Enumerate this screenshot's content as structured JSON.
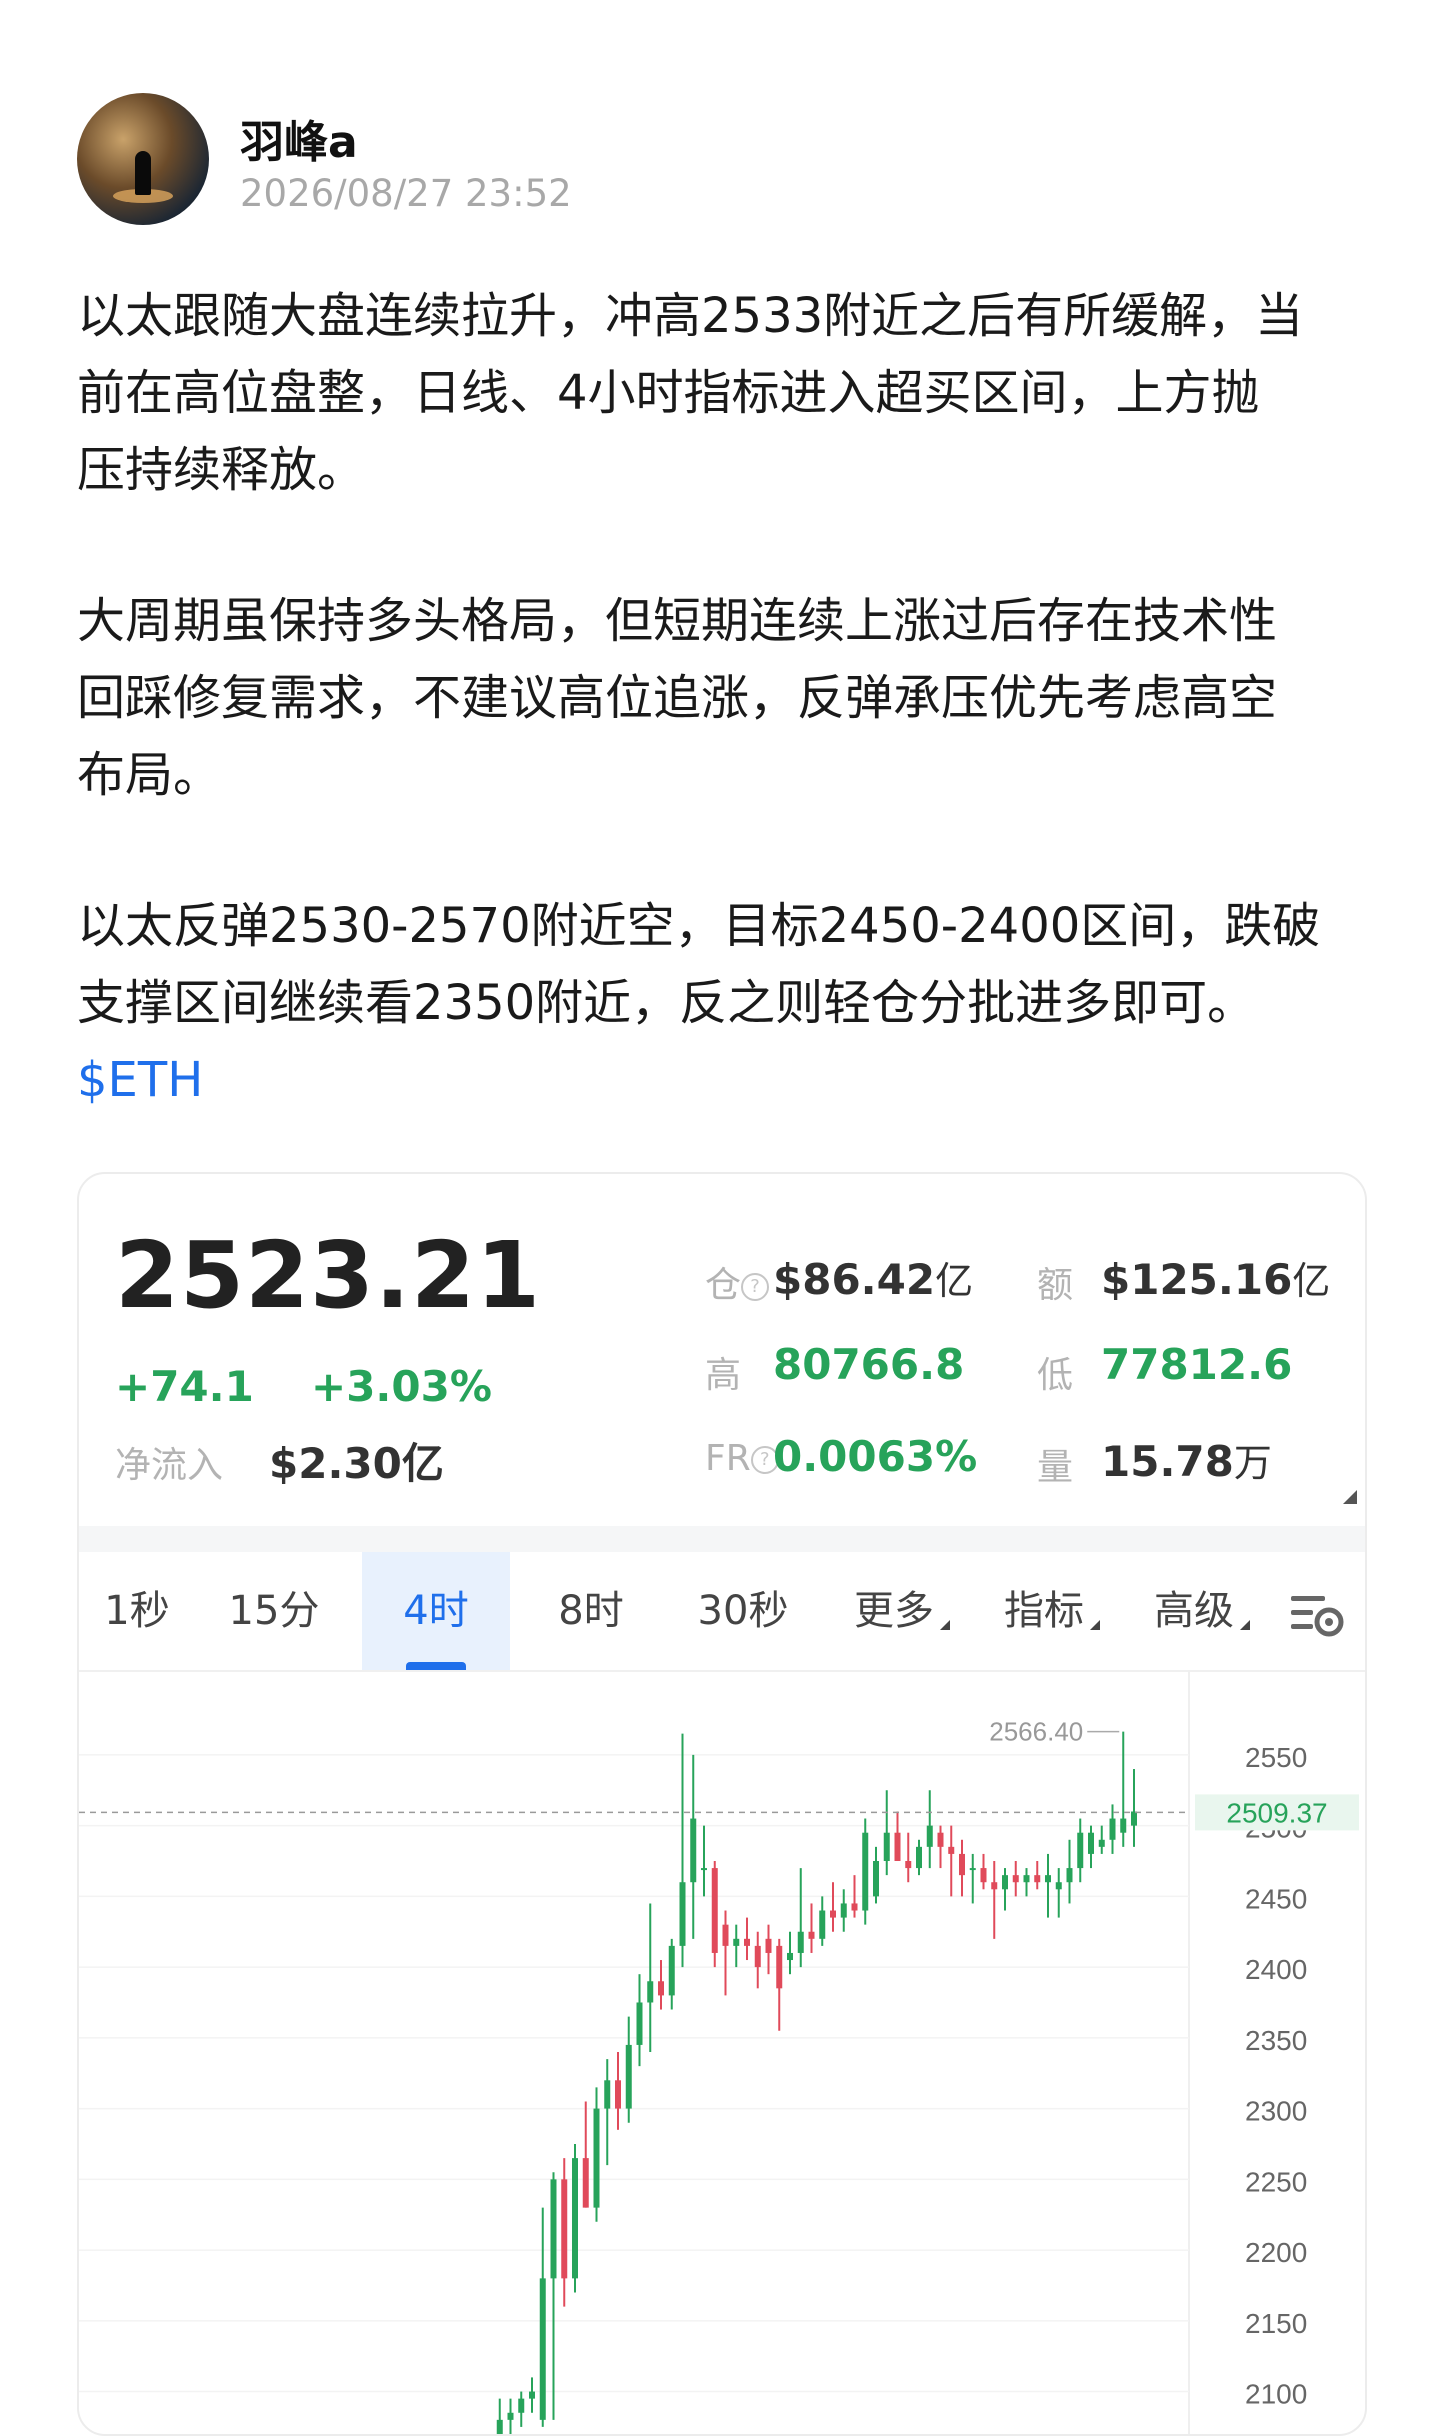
{
  "author": {
    "name": "羽峰a",
    "timestamp": "2026/08/27 23:52",
    "avatar_icon": "avatar-image"
  },
  "post": {
    "paragraph_1": "以太跟随大盘连续拉升，冲高2533附近之后有所缓解，当\n前在高位盘整，日线、4小时指标进入超买区间，上方抛\n压持续释放。",
    "paragraph_2": "大周期虽保持多头格局，但短期连续上涨过后存在技术性\n回踩修复需求，不建议高位追涨，反弹承压优先考虑高空\n布局。",
    "paragraph_3": "以太反弹2530-2570附近空，目标2450-2400区间，跌破\n支撑区间继续看2350附近，反之则轻仓分批进多即可。",
    "tag": "$ETH"
  },
  "ticker": {
    "price": "2523.21",
    "change_abs": "+74.1",
    "change_pct": "+3.03%",
    "net_inflow_label": "净流入",
    "net_inflow_value": "$2.30亿",
    "stats": {
      "position_label": "仓",
      "position_value": "$86.42",
      "position_unit": "亿",
      "turnover_label": "额",
      "turnover_value": "$125.16",
      "turnover_unit": "亿",
      "high_label": "高",
      "high_value": "80766.8",
      "low_label": "低",
      "low_value": "77812.6",
      "fr_label": "FR",
      "fr_value": "0.0063%",
      "volume_label": "量",
      "volume_value": "15.78",
      "volume_unit": "万"
    },
    "colors": {
      "up": "#27a35a",
      "down": "#e04a5a",
      "accent": "#1f6feb"
    }
  },
  "tabs": [
    {
      "label": "1秒"
    },
    {
      "label": "15分"
    },
    {
      "label": "4时",
      "active": true
    },
    {
      "label": "8时"
    },
    {
      "label": "30秒"
    },
    {
      "label": "更多",
      "dropdown": true
    },
    {
      "label": "指标",
      "dropdown": true
    },
    {
      "label": "高级",
      "dropdown": true
    }
  ],
  "tab_settings_icon": "chart-settings-icon",
  "chart_data": {
    "type": "candlestick",
    "y_ticks": [
      2550,
      2500,
      2450,
      2400,
      2350,
      2300,
      2250,
      2200,
      2150,
      2100
    ],
    "ylim": [
      2070,
      2610
    ],
    "current_price_label": "2509.37",
    "current_price": 2509.37,
    "max_label": "2566.40",
    "max_value": 2566.4,
    "candles": [
      {
        "o": 2060,
        "h": 2070,
        "l": 2040,
        "c": 2065
      },
      {
        "o": 2065,
        "h": 2095,
        "l": 2050,
        "c": 2080
      },
      {
        "o": 2080,
        "h": 2095,
        "l": 2070,
        "c": 2085
      },
      {
        "o": 2085,
        "h": 2100,
        "l": 2075,
        "c": 2095
      },
      {
        "o": 2095,
        "h": 2110,
        "l": 2085,
        "c": 2100
      },
      {
        "o": 2080,
        "h": 2230,
        "l": 2075,
        "c": 2180
      },
      {
        "o": 2180,
        "h": 2255,
        "l": 2080,
        "c": 2250
      },
      {
        "o": 2250,
        "h": 2265,
        "l": 2160,
        "c": 2180
      },
      {
        "o": 2180,
        "h": 2275,
        "l": 2170,
        "c": 2265
      },
      {
        "o": 2265,
        "h": 2305,
        "l": 2230,
        "c": 2230
      },
      {
        "o": 2230,
        "h": 2315,
        "l": 2220,
        "c": 2300
      },
      {
        "o": 2300,
        "h": 2335,
        "l": 2260,
        "c": 2320
      },
      {
        "o": 2320,
        "h": 2340,
        "l": 2285,
        "c": 2300
      },
      {
        "o": 2300,
        "h": 2365,
        "l": 2290,
        "c": 2345
      },
      {
        "o": 2345,
        "h": 2395,
        "l": 2330,
        "c": 2375
      },
      {
        "o": 2375,
        "h": 2445,
        "l": 2340,
        "c": 2390
      },
      {
        "o": 2390,
        "h": 2405,
        "l": 2370,
        "c": 2380
      },
      {
        "o": 2380,
        "h": 2420,
        "l": 2370,
        "c": 2415
      },
      {
        "o": 2415,
        "h": 2565,
        "l": 2400,
        "c": 2460
      },
      {
        "o": 2460,
        "h": 2550,
        "l": 2420,
        "c": 2505
      },
      {
        "o": 2470,
        "h": 2500,
        "l": 2450,
        "c": 2470
      },
      {
        "o": 2470,
        "h": 2475,
        "l": 2400,
        "c": 2410
      },
      {
        "o": 2430,
        "h": 2440,
        "l": 2380,
        "c": 2415
      },
      {
        "o": 2415,
        "h": 2430,
        "l": 2400,
        "c": 2420
      },
      {
        "o": 2420,
        "h": 2435,
        "l": 2405,
        "c": 2415
      },
      {
        "o": 2415,
        "h": 2425,
        "l": 2385,
        "c": 2400
      },
      {
        "o": 2420,
        "h": 2430,
        "l": 2395,
        "c": 2410
      },
      {
        "o": 2415,
        "h": 2420,
        "l": 2355,
        "c": 2385
      },
      {
        "o": 2405,
        "h": 2425,
        "l": 2395,
        "c": 2410
      },
      {
        "o": 2410,
        "h": 2470,
        "l": 2400,
        "c": 2425
      },
      {
        "o": 2425,
        "h": 2445,
        "l": 2410,
        "c": 2420
      },
      {
        "o": 2420,
        "h": 2450,
        "l": 2415,
        "c": 2440
      },
      {
        "o": 2440,
        "h": 2460,
        "l": 2425,
        "c": 2435
      },
      {
        "o": 2435,
        "h": 2455,
        "l": 2425,
        "c": 2445
      },
      {
        "o": 2445,
        "h": 2465,
        "l": 2435,
        "c": 2440
      },
      {
        "o": 2440,
        "h": 2505,
        "l": 2430,
        "c": 2495
      },
      {
        "o": 2450,
        "h": 2485,
        "l": 2445,
        "c": 2475
      },
      {
        "o": 2475,
        "h": 2525,
        "l": 2465,
        "c": 2495
      },
      {
        "o": 2495,
        "h": 2510,
        "l": 2475,
        "c": 2475
      },
      {
        "o": 2475,
        "h": 2495,
        "l": 2460,
        "c": 2470
      },
      {
        "o": 2470,
        "h": 2490,
        "l": 2465,
        "c": 2485
      },
      {
        "o": 2485,
        "h": 2525,
        "l": 2470,
        "c": 2500
      },
      {
        "o": 2495,
        "h": 2500,
        "l": 2470,
        "c": 2485
      },
      {
        "o": 2485,
        "h": 2500,
        "l": 2450,
        "c": 2480
      },
      {
        "o": 2480,
        "h": 2490,
        "l": 2450,
        "c": 2465
      },
      {
        "o": 2470,
        "h": 2480,
        "l": 2445,
        "c": 2470
      },
      {
        "o": 2470,
        "h": 2480,
        "l": 2455,
        "c": 2460
      },
      {
        "o": 2460,
        "h": 2475,
        "l": 2420,
        "c": 2455
      },
      {
        "o": 2455,
        "h": 2470,
        "l": 2440,
        "c": 2465
      },
      {
        "o": 2465,
        "h": 2475,
        "l": 2450,
        "c": 2460
      },
      {
        "o": 2460,
        "h": 2470,
        "l": 2450,
        "c": 2465
      },
      {
        "o": 2465,
        "h": 2475,
        "l": 2455,
        "c": 2460
      },
      {
        "o": 2460,
        "h": 2480,
        "l": 2435,
        "c": 2465
      },
      {
        "o": 2455,
        "h": 2470,
        "l": 2435,
        "c": 2460
      },
      {
        "o": 2460,
        "h": 2490,
        "l": 2445,
        "c": 2470
      },
      {
        "o": 2470,
        "h": 2505,
        "l": 2460,
        "c": 2495
      },
      {
        "o": 2480,
        "h": 2500,
        "l": 2470,
        "c": 2495
      },
      {
        "o": 2485,
        "h": 2500,
        "l": 2480,
        "c": 2490
      },
      {
        "o": 2490,
        "h": 2515,
        "l": 2480,
        "c": 2505
      },
      {
        "o": 2495,
        "h": 2566.4,
        "l": 2485,
        "c": 2505
      },
      {
        "o": 2500,
        "h": 2540,
        "l": 2485,
        "c": 2510
      }
    ]
  }
}
